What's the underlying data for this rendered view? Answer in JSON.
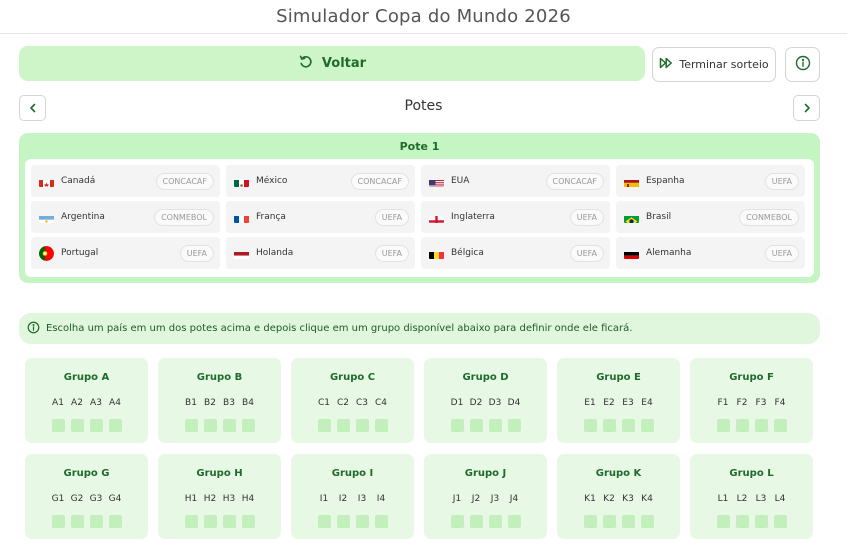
{
  "app": {
    "title": "Simulador Copa do Mundo 2026"
  },
  "toolbar": {
    "back_label": "Voltar",
    "finish_label": "Terminar sorteio"
  },
  "section": {
    "title": "Potes"
  },
  "pot": {
    "title": "Pote 1",
    "teams": [
      {
        "name": "Canadá",
        "conf": "CONCACAF",
        "flag": "canada"
      },
      {
        "name": "México",
        "conf": "CONCACAF",
        "flag": "mexico"
      },
      {
        "name": "EUA",
        "conf": "CONCACAF",
        "flag": "usa"
      },
      {
        "name": "Espanha",
        "conf": "UEFA",
        "flag": "spain"
      },
      {
        "name": "Argentina",
        "conf": "CONMEBOL",
        "flag": "argentina"
      },
      {
        "name": "França",
        "conf": "UEFA",
        "flag": "france"
      },
      {
        "name": "Inglaterra",
        "conf": "UEFA",
        "flag": "england"
      },
      {
        "name": "Brasil",
        "conf": "CONMEBOL",
        "flag": "brazil"
      },
      {
        "name": "Portugal",
        "conf": "UEFA",
        "flag": "portugal"
      },
      {
        "name": "Holanda",
        "conf": "UEFA",
        "flag": "netherlands"
      },
      {
        "name": "Bélgica",
        "conf": "UEFA",
        "flag": "belgium"
      },
      {
        "name": "Alemanha",
        "conf": "UEFA",
        "flag": "germany"
      }
    ]
  },
  "instruction": "Escolha um país em um dos potes acima e depois clique em um grupo disponível abaixo para definir onde ele ficará.",
  "groups": [
    {
      "title": "Grupo A",
      "slots": [
        "A1",
        "A2",
        "A3",
        "A4"
      ]
    },
    {
      "title": "Grupo B",
      "slots": [
        "B1",
        "B2",
        "B3",
        "B4"
      ]
    },
    {
      "title": "Grupo C",
      "slots": [
        "C1",
        "C2",
        "C3",
        "C4"
      ]
    },
    {
      "title": "Grupo D",
      "slots": [
        "D1",
        "D2",
        "D3",
        "D4"
      ]
    },
    {
      "title": "Grupo E",
      "slots": [
        "E1",
        "E2",
        "E3",
        "E4"
      ]
    },
    {
      "title": "Grupo F",
      "slots": [
        "F1",
        "F2",
        "F3",
        "F4"
      ]
    },
    {
      "title": "Grupo G",
      "slots": [
        "G1",
        "G2",
        "G3",
        "G4"
      ]
    },
    {
      "title": "Grupo H",
      "slots": [
        "H1",
        "H2",
        "H3",
        "H4"
      ]
    },
    {
      "title": "Grupo I",
      "slots": [
        "I1",
        "I2",
        "I3",
        "I4"
      ]
    },
    {
      "title": "Grupo J",
      "slots": [
        "J1",
        "J2",
        "J3",
        "J4"
      ]
    },
    {
      "title": "Grupo K",
      "slots": [
        "K1",
        "K2",
        "K3",
        "K4"
      ]
    },
    {
      "title": "Grupo L",
      "slots": [
        "L1",
        "L2",
        "L3",
        "L4"
      ]
    }
  ],
  "colors": {
    "accent_green": "#1e6b2c",
    "button_green": "#cdf5c8",
    "pot_green": "#c5f5c3",
    "group_bg": "#e7f8e4",
    "slot_green": "#c3efbd"
  },
  "icons": {
    "back": "refresh-icon",
    "finish": "fast-forward-icon",
    "info": "info-icon",
    "prev": "chevron-left-icon",
    "next": "chevron-right-icon"
  }
}
